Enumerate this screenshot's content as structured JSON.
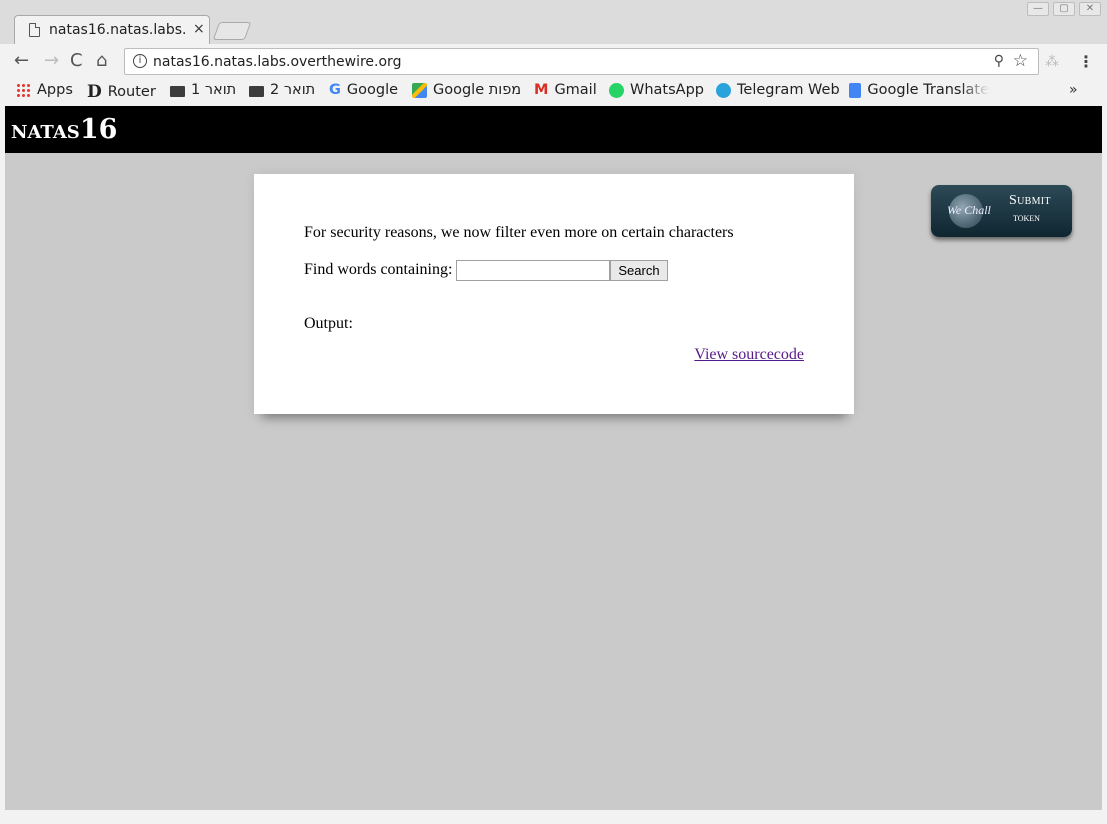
{
  "browser": {
    "tab": {
      "title": "natas16.natas.labs.",
      "close": "×"
    },
    "toolbar": {
      "back": "←",
      "forward": "→",
      "reload": "C",
      "home": "⌂",
      "url": "natas16.natas.labs.overthewire.org",
      "info": "i",
      "key": "⚲",
      "star": "☆",
      "menu": "⋮",
      "extension": "⁂"
    },
    "window_controls": [
      "—",
      "▢",
      "✕"
    ],
    "bookmarks": [
      {
        "label": "Apps",
        "icon": "apps-icon"
      },
      {
        "label": "Router",
        "icon": "router-icon",
        "glyph": "D"
      },
      {
        "label": "תואר 1",
        "icon": "folder-icon"
      },
      {
        "label": "תואר 2",
        "icon": "folder-icon"
      },
      {
        "label": "Google",
        "icon": "google-icon",
        "glyph": "G"
      },
      {
        "label": "Google מפות",
        "icon": "google-maps-icon"
      },
      {
        "label": "Gmail",
        "icon": "gmail-icon",
        "glyph": "M"
      },
      {
        "label": "WhatsApp",
        "icon": "whatsapp-icon"
      },
      {
        "label": "Telegram Web",
        "icon": "telegram-icon"
      },
      {
        "label": "Google Translate",
        "icon": "google-translate-icon"
      }
    ],
    "bookmarks_more": "»"
  },
  "page": {
    "header": {
      "prefix": "natas",
      "number": "16"
    },
    "message": "For security reasons, we now filter even more on certain characters",
    "search_label": "Find words containing:",
    "search_value": "",
    "search_button": "Search",
    "output_label": "Output:",
    "source_link": "View sourcecode",
    "wechall": {
      "logo_text": "We Chall",
      "submit": "Submit",
      "token": "token"
    }
  }
}
